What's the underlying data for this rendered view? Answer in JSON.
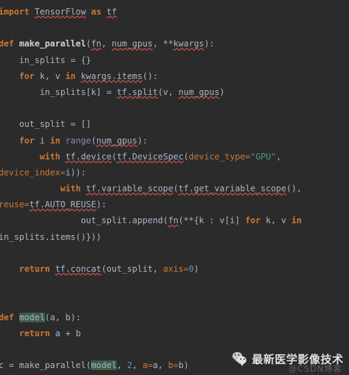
{
  "editor": {
    "language": "Python",
    "background_color": "#2b2b2b",
    "default_text_color": "#a9b7c6",
    "keyword_color": "#cc7832",
    "string_color": "#4a9c8c",
    "number_color": "#6897bb",
    "builtin_color": "#8888c6",
    "highlight_color": "#3d5d46",
    "spellcheck_underline_color": "#c75450",
    "lines": [
      "import TensorFlow as tf",
      "",
      "def make_parallel(fn, num_gpus, **kwargs):",
      "    in_splits = {}",
      "    for k, v in kwargs.items():",
      "        in_splits[k] = tf.split(v, num_gpus)",
      "",
      "    out_split = []",
      "    for i in range(num_gpus):",
      "        with tf.device(tf.DeviceSpec(device_type=\"GPU\", device_index=i)):",
      "            with tf.variable_scope(tf.get_variable_scope(), reuse=tf.AUTO_REUSE):",
      "                out_split.append(fn(**{k : v[i] for k, v in in_splits.items()}))",
      "",
      "    return tf.concat(out_split, axis=0)",
      "",
      "",
      "def model(a, b):",
      "    return a + b",
      "",
      "c = make_parallel(model, 2, a=a, b=b)"
    ],
    "tokens": {
      "kw_import": "import",
      "kw_as": "as",
      "kw_def": "def",
      "kw_for": "for",
      "kw_in": "in",
      "kw_with": "with",
      "kw_return": "return",
      "name_tensorflow": "TensorFlow",
      "name_tf": "tf",
      "fn_make_parallel": "make_parallel",
      "fn_model": "model",
      "arg_fn": "fn",
      "arg_num_gpus": "num_gpus",
      "arg_kwargs": "**kwargs",
      "var_in_splits": "in_splits",
      "var_out_split": "out_split",
      "builtin_range": "range",
      "str_gpu": "\"GPU\"",
      "kwarg_device_type": "device_type=",
      "kwarg_device_index": "device_index=",
      "kwarg_reuse": "reuse=",
      "kwarg_axis": "axis=",
      "num_zero": "0",
      "num_two": "2"
    }
  },
  "watermark": {
    "logo_name": "wechat-logo-icon",
    "title": "最新医学影像技术",
    "subtitle": "@CSDN博客"
  }
}
